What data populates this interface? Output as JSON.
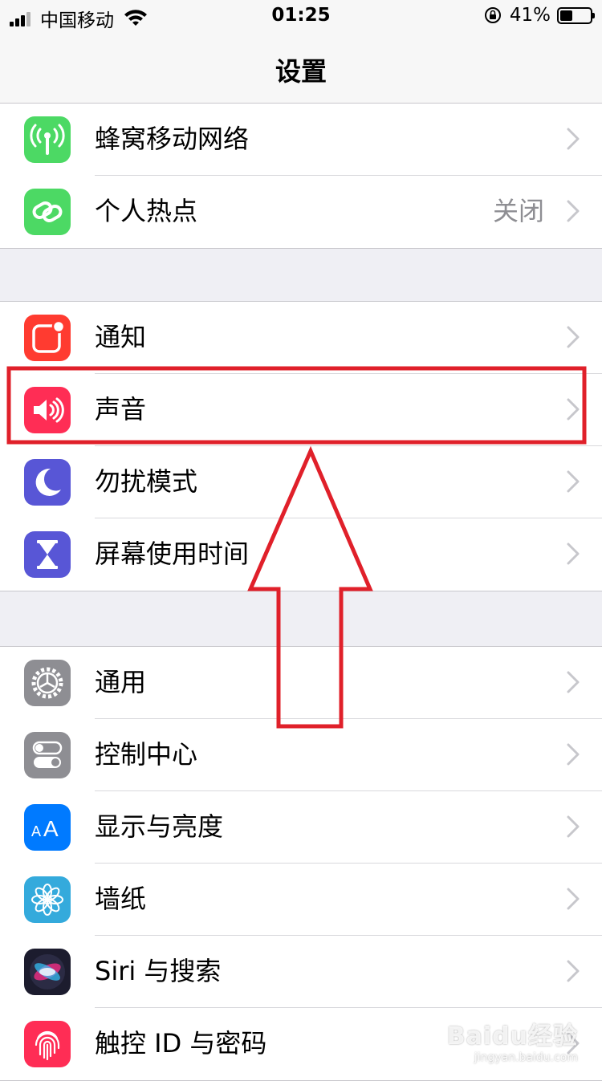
{
  "status_bar": {
    "carrier": "中国移动",
    "time": "01:25",
    "battery_percent": "41%",
    "battery_level": 0.41
  },
  "nav": {
    "title": "设置"
  },
  "groups": [
    {
      "items": [
        {
          "label": "蜂窝移动网络",
          "icon": "antenna-icon",
          "color": "#4cd964"
        },
        {
          "label": "个人热点",
          "value": "关闭",
          "icon": "hotspot-chain-icon",
          "color": "#4cd964"
        }
      ]
    },
    {
      "items": [
        {
          "label": "通知",
          "icon": "notification-icon",
          "color": "#ff3b30"
        },
        {
          "label": "声音",
          "icon": "speaker-icon",
          "color": "#ff2d55"
        },
        {
          "label": "勿扰模式",
          "icon": "moon-icon",
          "color": "#5856d6"
        },
        {
          "label": "屏幕使用时间",
          "icon": "hourglass-icon",
          "color": "#5856d6"
        }
      ]
    },
    {
      "items": [
        {
          "label": "通用",
          "icon": "gear-icon",
          "color": "#8e8e93"
        },
        {
          "label": "控制中心",
          "icon": "toggles-icon",
          "color": "#8e8e93"
        },
        {
          "label": "显示与亮度",
          "icon": "text-size-icon",
          "color": "#007aff"
        },
        {
          "label": "墙纸",
          "icon": "flower-icon",
          "color": "#34aadc"
        },
        {
          "label": "Siri 与搜索",
          "icon": "siri-icon",
          "color": "#1c1c2e"
        },
        {
          "label": "触控 ID 与密码",
          "icon": "fingerprint-icon",
          "color": "#ff2d55"
        }
      ]
    }
  ],
  "annotation": {
    "highlight_color": "#e0202a",
    "highlighted_item": "声音"
  },
  "watermark": {
    "brand": "Baidu经验",
    "domain": "jingyan.baidu.com"
  }
}
